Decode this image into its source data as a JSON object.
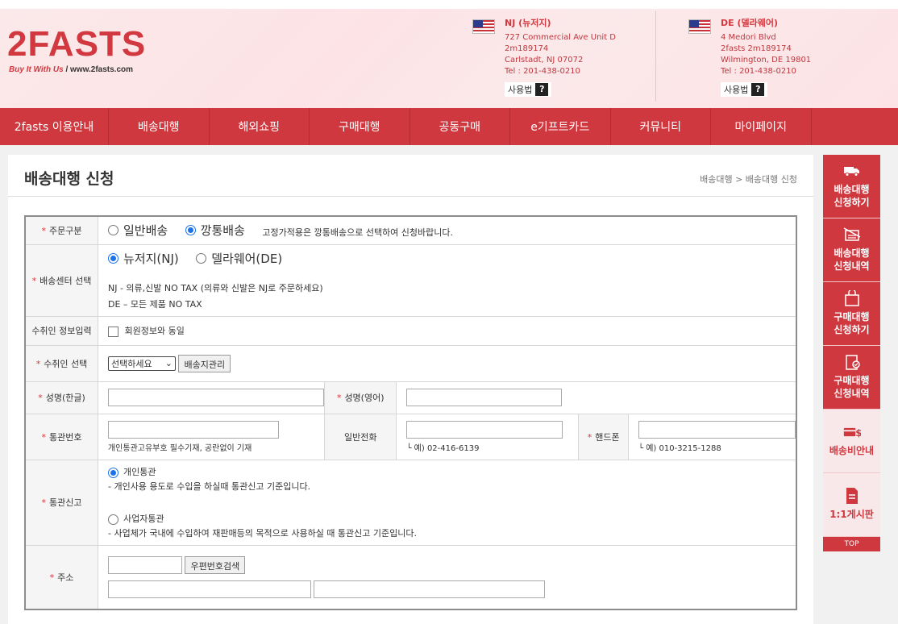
{
  "header": {
    "logo": "2FASTS",
    "tagline_em": "Buy It With Us",
    "tagline_sep": "/",
    "tagline_url": "www.2fasts.com",
    "nj": {
      "title": "NJ (뉴저지)",
      "line1": "727 Commercial Ave Unit D",
      "line2": "2m189174",
      "line3": "Carlstadt,  NJ  07072",
      "line4": "Tel : 201-438-0210",
      "usage": "사용법",
      "help": "?"
    },
    "de": {
      "title": "DE (델라웨어)",
      "line1": "4 Medori Blvd",
      "line2": "2fasts 2m189174",
      "line3": "Wilmington,  DE  19801",
      "line4": "Tel : 201-438-0210",
      "usage": "사용법",
      "help": "?"
    }
  },
  "nav": [
    "2fasts 이용안내",
    "배송대행",
    "해외쇼핑",
    "구매대행",
    "공동구매",
    "e기프트카드",
    "커뮤니티",
    "마이페이지"
  ],
  "page": {
    "title": "배송대행 신청",
    "breadcrumb": "배송대행 > 배송대행 신청"
  },
  "form": {
    "order_type": {
      "label": "주문구분",
      "opt1": "일반배송",
      "opt2": "깡통배송",
      "note": "고정가적용은 깡통배송으로 선택하여 신청바랍니다."
    },
    "center": {
      "label": "배송센터 선택",
      "opt1": "뉴저지(NJ)",
      "opt2": "델라웨어(DE)",
      "note1": "NJ - 의류,신발 NO TAX (의류와 신발은 NJ로 주문하세요)",
      "note2": "DE – 모든 제품 NO TAX"
    },
    "receiver_info": {
      "label": "수취인 정보입력",
      "check": "회원정보와 동일"
    },
    "receiver_select": {
      "label": "수취인 선택",
      "select": "선택하세요",
      "btn": "배송지관리"
    },
    "name": {
      "label_kr": "성명(한글)",
      "label_en": "성명(영어)"
    },
    "customs": {
      "label": "통관번호",
      "hint": "개인통관고유부호 필수기재, 공란없이 기재",
      "phone_label": "일반전화",
      "phone_hint": "└ 예) 02-416-6139",
      "mobile_label": "핸드폰",
      "mobile_hint": "└ 예) 010-3215-1288"
    },
    "declare": {
      "label": "통관신고",
      "opt1": "개인통관",
      "desc1": "- 개인사용 용도로 수입을 하실때 통관신고 기준입니다.",
      "opt2": "사업자통관",
      "desc2": "- 사업체가 국내에 수입하여 재판매등의 목적으로 사용하실 때 통관신고 기준입니다."
    },
    "address": {
      "label": "주소",
      "btn": "우편번호검색"
    }
  },
  "sidebar": {
    "item1": [
      "배송대행",
      "신청하기"
    ],
    "item2": [
      "배송대행",
      "신청내역"
    ],
    "item3": [
      "구매대행",
      "신청하기"
    ],
    "item4": [
      "구매대행",
      "신청내역"
    ],
    "item5": "배송비안내",
    "item6": "1:1게시판",
    "top": "TOP"
  },
  "colors": {
    "brand": "#d0383f",
    "radio": "#1a73e8"
  }
}
